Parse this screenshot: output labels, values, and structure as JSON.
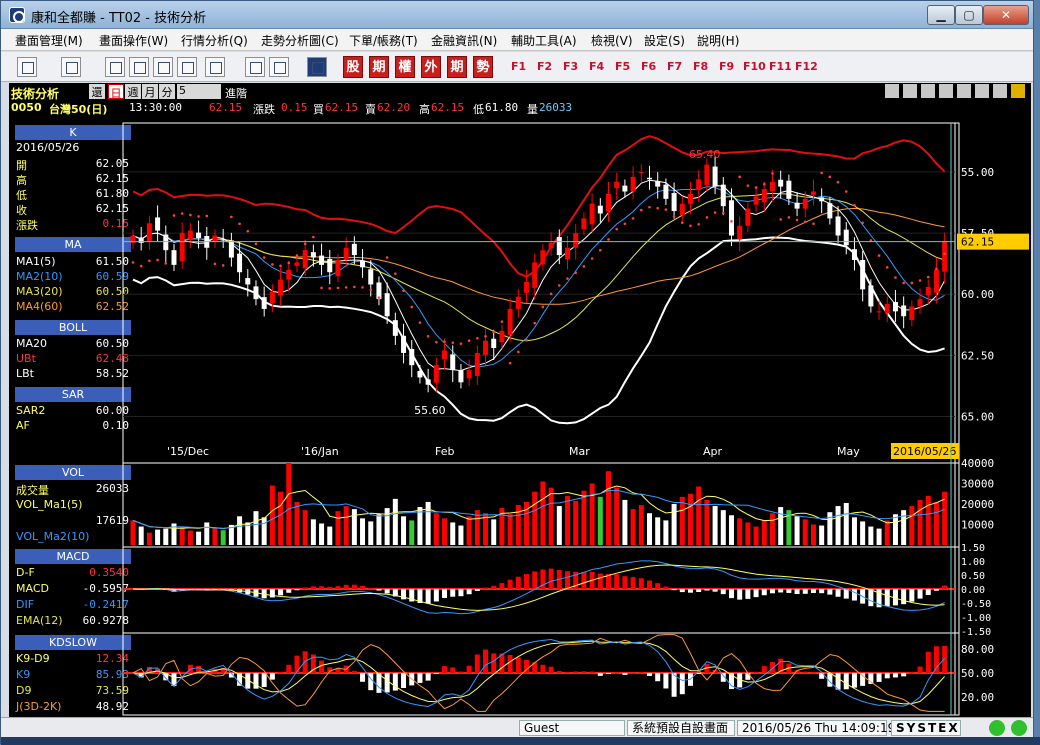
{
  "window": {
    "title": "康和全都賺 - TT02 - 技術分析",
    "min_label": "▁",
    "max_label": "▢",
    "close_label": "✕"
  },
  "menu": [
    "畫面管理(M)",
    "畫面操作(W)",
    "行情分析(Q)",
    "走勢分析圖(C)",
    "下單/帳務(T)",
    "金融資訊(N)",
    "輔助工具(A)",
    "檢視(V)",
    "設定(S)",
    "說明(H)"
  ],
  "toolbar": {
    "red_buttons": [
      "股",
      "期",
      "權",
      "外",
      "期",
      "勢"
    ],
    "fkeys": [
      "F1",
      "F2",
      "F3",
      "F4",
      "F5",
      "F6",
      "F7",
      "F8",
      "F9",
      "F10",
      "F11",
      "F12"
    ]
  },
  "header": {
    "title": "技術分析",
    "period_buttons": [
      "還",
      "日",
      "週",
      "月",
      "分"
    ],
    "interval_value": "5",
    "advanced_label": "進階",
    "symbol": "0050",
    "symbol_name": "台灣50(日)",
    "time": "13:30:00",
    "price": "62.15",
    "change_label": "漲跌",
    "change": "0.15",
    "buy_label": "買",
    "buy": "62.15",
    "sell_label": "賣",
    "sell": "62.20",
    "high_label": "高",
    "high": "62.15",
    "low_label": "低",
    "low": "61.80",
    "vol_label": "量",
    "vol": "26033"
  },
  "panels": {
    "k": {
      "title": "K",
      "date": "2016/05/26",
      "rows": [
        {
          "k": "開",
          "v": "62.05"
        },
        {
          "k": "高",
          "v": "62.15"
        },
        {
          "k": "低",
          "v": "61.80"
        },
        {
          "k": "收",
          "v": "62.15"
        },
        {
          "k": "漲跌",
          "v": "0.15"
        }
      ]
    },
    "ma": {
      "title": "MA",
      "rows": [
        {
          "k": "MA1(5)",
          "v": "61.50"
        },
        {
          "k": "MA2(10)",
          "v": "60.59"
        },
        {
          "k": "MA3(20)",
          "v": "60.50"
        },
        {
          "k": "MA4(60)",
          "v": "62.52"
        }
      ]
    },
    "boll": {
      "title": "BOLL",
      "rows": [
        {
          "k": "MA20",
          "v": "60.50"
        },
        {
          "k": "UBt",
          "v": "62.48"
        },
        {
          "k": "LBt",
          "v": "58.52"
        }
      ]
    },
    "sar": {
      "title": "SAR",
      "rows": [
        {
          "k": "SAR2",
          "v": "60.00"
        },
        {
          "k": "AF",
          "v": "0.10"
        }
      ]
    },
    "vol": {
      "title": "VOL",
      "rows": [
        {
          "k": "成交量",
          "v": "26033"
        },
        {
          "k": "VOL_Ma1(5)",
          "v": ""
        },
        {
          "k": "",
          "v": "17619"
        },
        {
          "k": "VOL_Ma2(10)",
          "v": ""
        }
      ]
    },
    "macd": {
      "title": "MACD",
      "rows": [
        {
          "k": "D-F",
          "v": "0.3540"
        },
        {
          "k": "MACD",
          "v": "-0.5957"
        },
        {
          "k": "DIF",
          "v": "-0.2417"
        },
        {
          "k": "EMA(12)",
          "v": "60.9278"
        }
      ]
    },
    "kd": {
      "title": "KDSLOW",
      "rows": [
        {
          "k": "K9-D9",
          "v": "12.34"
        },
        {
          "k": "K9",
          "v": "85.93"
        },
        {
          "k": "D9",
          "v": "73.59"
        },
        {
          "k": "J(3D-2K)",
          "v": "48.92"
        }
      ]
    }
  },
  "price_axis": [
    "65.00",
    "62.50",
    "60.00",
    "57.50",
    "55.00"
  ],
  "current_price_tag": "62.15",
  "annotations": {
    "high": "65.40",
    "low": "55.60"
  },
  "date_axis": [
    "'15/Dec",
    "'16/Jan",
    "Feb",
    "Mar",
    "Apr",
    "May"
  ],
  "date_cursor": "2016/05/26",
  "vol_axis": [
    "40000",
    "30000",
    "20000",
    "10000"
  ],
  "macd_axis": [
    "1.50",
    "1.00",
    "0.50",
    "0.00",
    "-0.50",
    "-1.00",
    "-1.50"
  ],
  "kd_axis": [
    "80.00",
    "50.00",
    "20.00"
  ],
  "colors": {
    "up": "#ff0000",
    "down": "#ffffff",
    "ma1": "#ffffff",
    "ma2": "#3399ff",
    "ma3": "#e6e64c",
    "ma4": "#ff9933",
    "boll_up": "#e01010",
    "boll_low": "#ffffff"
  },
  "chart_data": [
    {
      "type": "candlestick",
      "title": "",
      "x": [
        "'15/Dec",
        "'16/Jan",
        "Feb",
        "Mar",
        "Apr",
        "May",
        "2016/05/26"
      ],
      "ylim": [
        54,
        67
      ],
      "y_ticks": [
        55.0,
        57.5,
        60.0,
        62.5,
        65.0
      ],
      "close_series": [
        62.4,
        62.1,
        62.9,
        62.6,
        61.8,
        61.2,
        62.5,
        62.6,
        62.3,
        61.9,
        62.4,
        62.2,
        61.5,
        60.9,
        60.4,
        59.8,
        59.4,
        60.1,
        60.6,
        61.0,
        61.3,
        61.8,
        61.5,
        61.2,
        60.9,
        61.4,
        61.9,
        61.6,
        61.1,
        60.4,
        59.8,
        59.1,
        58.3,
        57.6,
        57.1,
        56.6,
        56.3,
        57.1,
        57.7,
        56.9,
        56.4,
        56.9,
        57.6,
        58.1,
        57.8,
        58.5,
        59.4,
        59.9,
        60.5,
        61.3,
        61.8,
        62.1,
        61.6,
        61.9,
        62.5,
        63.1,
        63.7,
        63.3,
        64.1,
        64.6,
        64.2,
        64.8,
        65.0,
        64.7,
        64.4,
        63.9,
        63.4,
        63.7,
        64.1,
        64.7,
        65.3,
        64.4,
        63.6,
        62.4,
        62.8,
        63.5,
        64.0,
        64.3,
        64.6,
        64.4,
        63.9,
        63.5,
        63.9,
        64.2,
        63.8,
        63.1,
        62.4,
        62.0,
        61.4,
        60.2,
        59.5,
        59.3,
        59.6,
        59.3,
        59.1,
        59.5,
        59.8,
        60.3,
        61.0,
        62.15
      ],
      "series": [
        {
          "name": "MA1(5)",
          "last": 61.5
        },
        {
          "name": "MA2(10)",
          "last": 60.59
        },
        {
          "name": "MA3(20)",
          "last": 60.5
        },
        {
          "name": "MA4(60)",
          "last": 62.52
        }
      ],
      "boll": {
        "ma20": 60.5,
        "upper": 62.48,
        "lower": 58.52
      },
      "sar": 60.0,
      "high_mark": 65.4,
      "low_mark": 55.6
    },
    {
      "type": "bar",
      "ylim": [
        0,
        40000
      ],
      "values": [
        12000,
        9000,
        6000,
        7500,
        8000,
        10500,
        9000,
        7000,
        6500,
        11000,
        8500,
        7200,
        9800,
        14000,
        11000,
        16500,
        13500,
        29000,
        26000,
        40000,
        21000,
        17000,
        12500,
        10500,
        9000,
        16500,
        19000,
        17500,
        13000,
        11500,
        15000,
        18000,
        22500,
        14000,
        12000,
        18500,
        21000,
        15500,
        13000,
        11000,
        9500,
        14000,
        17000,
        15500,
        12500,
        18000,
        15000,
        19500,
        21000,
        26000,
        31000,
        28000,
        19000,
        24000,
        21500,
        26500,
        30000,
        23500,
        36000,
        28000,
        22000,
        17500,
        19500,
        15500,
        13500,
        12000,
        20000,
        23500,
        25000,
        28500,
        22000,
        19000,
        17000,
        14500,
        13000,
        11000,
        9000,
        12000,
        15500,
        18500,
        17000,
        14000,
        12500,
        10000,
        9500,
        16000,
        19000,
        20500,
        13500,
        11500,
        9000,
        8000,
        12000,
        15000,
        17000,
        19000,
        22000,
        24000,
        21000,
        26033
      ],
      "ma1_last": 17619
    },
    {
      "type": "bar",
      "ylim": [
        -1.5,
        1.5
      ],
      "macd_ticks": [
        1.5,
        1.0,
        0.5,
        0.0,
        -0.5,
        -1.0,
        -1.5
      ]
    },
    {
      "type": "line",
      "ylim": [
        0,
        100
      ],
      "kd_ticks": [
        80.0,
        50.0,
        20.0
      ],
      "k_last": 85.93,
      "d_last": 73.59
    }
  ],
  "status": {
    "user": "Guest",
    "page": "系統預設自設畫面",
    "datetime": "2016/05/26 Thu 14:09:19",
    "brand": "SYSTEX"
  }
}
